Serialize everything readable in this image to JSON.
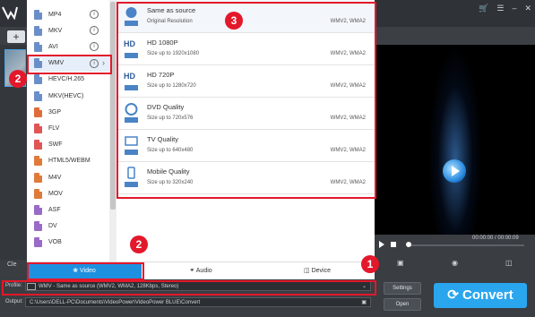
{
  "format_list": [
    {
      "label": "MP4",
      "color": "#6a8fc8"
    },
    {
      "label": "MKV",
      "color": "#6a8fc8"
    },
    {
      "label": "AVI",
      "color": "#6a8fc8"
    },
    {
      "label": "WMV",
      "color": "#6a8fc8",
      "selected": true
    },
    {
      "label": "HEVC/H.265",
      "color": "#6a8fc8"
    },
    {
      "label": "MKV(HEVC)",
      "color": "#6a8fc8"
    },
    {
      "label": "3GP",
      "color": "#e06c3a"
    },
    {
      "label": "FLV",
      "color": "#e05555"
    },
    {
      "label": "SWF",
      "color": "#e05555"
    },
    {
      "label": "HTML5/WEBM",
      "color": "#e07a3a"
    },
    {
      "label": "M4V",
      "color": "#e07a3a"
    },
    {
      "label": "MOV",
      "color": "#e07a3a"
    },
    {
      "label": "ASF",
      "color": "#9a6ac8"
    },
    {
      "label": "DV",
      "color": "#9a6ac8"
    },
    {
      "label": "VOB",
      "color": "#9a6ac8"
    }
  ],
  "quality_list": [
    {
      "name": "Same as source",
      "size": "Original Resolution",
      "codec": "WMV2, WMA2",
      "icon": "source-icon"
    },
    {
      "name": "HD 1080P",
      "size": "Size up to 1920x1080",
      "codec": "WMV2, WMA2",
      "icon": "hd-1080-icon"
    },
    {
      "name": "HD 720P",
      "size": "Size up to 1280x720",
      "codec": "WMV2, WMA2",
      "icon": "hd-720-icon"
    },
    {
      "name": "DVD Quality",
      "size": "Size up to 720x576",
      "codec": "WMV2, WMA2",
      "icon": "dvd-icon"
    },
    {
      "name": "TV Quality",
      "size": "Size up to 640x480",
      "codec": "WMV2, WMA2",
      "icon": "tv-icon"
    },
    {
      "name": "Mobile Quality",
      "size": "Size up to 320x240",
      "codec": "WMV2, WMA2",
      "icon": "mobile-icon"
    }
  ],
  "tabs": [
    {
      "label": "Video",
      "icon": "video-reel-icon"
    },
    {
      "label": "Audio",
      "icon": "headphones-icon"
    },
    {
      "label": "Device",
      "icon": "device-icon"
    }
  ],
  "profile": {
    "label": "Profile:",
    "value": "WMV - Same as source (WMV2, WMA2, 128Kbps, Stereo)"
  },
  "output": {
    "label": "Output:",
    "value": "C:\\Users\\DELL-PC\\Documents\\VideoPower\\VideoPower BLUE\\Convert"
  },
  "buttons": {
    "settings": "Settings",
    "open": "Open",
    "convert": "Convert"
  },
  "player": {
    "time": "00:00:00 / 00:00:09"
  },
  "annotations": {
    "one": "1",
    "two_a": "2",
    "two_b": "2",
    "three": "3"
  },
  "clear_label": "Cle",
  "colors": {
    "accent": "#1e90e0",
    "annotation": "#e3182b",
    "convert": "#2aa6ef"
  }
}
